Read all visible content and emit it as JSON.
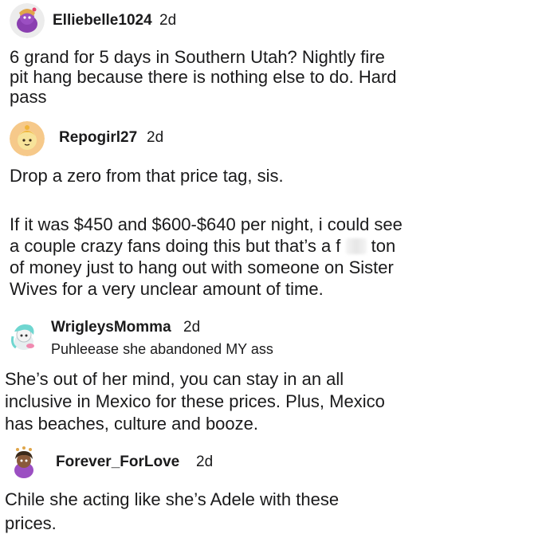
{
  "comments": [
    {
      "username": "Elliebelle1024",
      "time": "2d",
      "avatar_icon": "snoo-avatar-icon",
      "lines": [
        "6 grand for 5 days in Southern Utah?  Nightly fire",
        "pit hang  because there is nothing else to do.  Hard",
        "pass"
      ]
    },
    {
      "username": "Repogirl27",
      "time": "2d",
      "avatar_icon": "animal-crossing-avatar-icon",
      "lines": [
        "Drop a zero from that price tag, sis.",
        "If it was $450 and $600-$640 per night, i could see",
        "a couple crazy fans doing this but that’s a f",
        "ton",
        "of money just to hang out with someone on Sister",
        "Wives for a very unclear amount of time."
      ]
    },
    {
      "username": "WrigleysMomma",
      "time": "2d",
      "flair": "Puhleease she abandoned MY ass",
      "avatar_icon": "snoo-avatar-icon",
      "lines": [
        "She’s out of her mind, you can stay in an all",
        "inclusive in Mexico for these prices.  Plus, Mexico",
        "has beaches, culture and booze."
      ]
    },
    {
      "username": "Forever_ForLove",
      "time": "2d",
      "avatar_icon": "snoo-avatar-icon",
      "lines": [
        "Chile she acting like she’s Adele with these",
        "prices."
      ]
    }
  ]
}
